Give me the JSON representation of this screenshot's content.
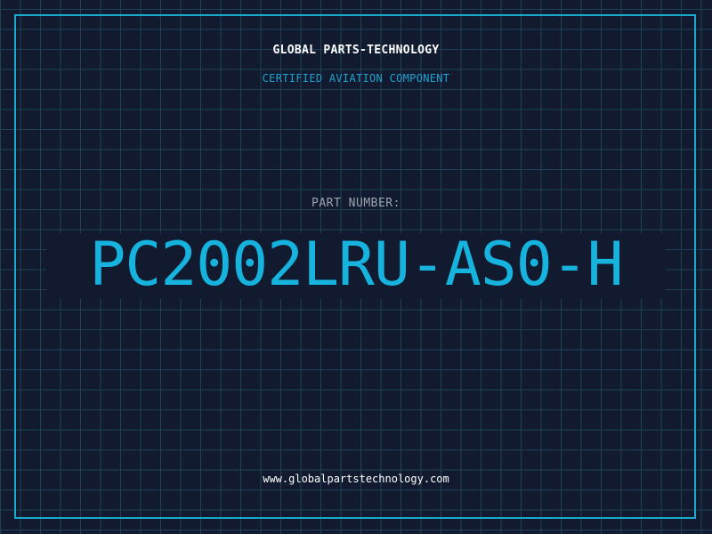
{
  "header": {
    "company": "GLOBAL PARTS-TECHNOLOGY",
    "tagline": "CERTIFIED AVIATION COMPONENT"
  },
  "part": {
    "label": "PART NUMBER:",
    "number": "PC2002LRU-AS0-H"
  },
  "footer": {
    "website": "www.globalpartstechnology.com"
  },
  "colors": {
    "background": "#111a2e",
    "grid": "#1f4257",
    "accent": "#16b3df",
    "frame": "#1aa8cc"
  }
}
